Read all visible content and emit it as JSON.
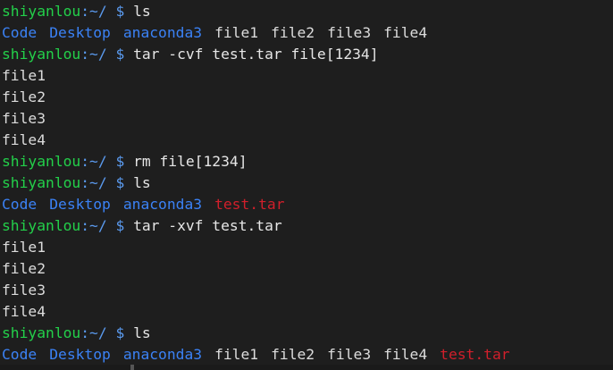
{
  "prompt": {
    "user": "shiyanlou",
    "sep": ":~/ $ "
  },
  "lines": [
    {
      "type": "cmd",
      "text": "ls"
    },
    {
      "type": "ls",
      "items": [
        {
          "text": "Code",
          "kind": "dir"
        },
        {
          "text": "Desktop",
          "kind": "dir"
        },
        {
          "text": "anaconda3",
          "kind": "dir"
        },
        {
          "text": "file1",
          "kind": "file"
        },
        {
          "text": "file2",
          "kind": "file"
        },
        {
          "text": "file3",
          "kind": "file"
        },
        {
          "text": "file4",
          "kind": "file"
        }
      ]
    },
    {
      "type": "cmd",
      "text": "tar -cvf test.tar file[1234]"
    },
    {
      "type": "out",
      "text": "file1"
    },
    {
      "type": "out",
      "text": "file2"
    },
    {
      "type": "out",
      "text": "file3"
    },
    {
      "type": "out",
      "text": "file4"
    },
    {
      "type": "cmd",
      "text": "rm file[1234]"
    },
    {
      "type": "cmd",
      "text": "ls"
    },
    {
      "type": "ls",
      "items": [
        {
          "text": "Code",
          "kind": "dir"
        },
        {
          "text": "Desktop",
          "kind": "dir"
        },
        {
          "text": "anaconda3",
          "kind": "dir"
        },
        {
          "text": "test.tar",
          "kind": "archive"
        }
      ]
    },
    {
      "type": "cmd",
      "text": "tar -xvf test.tar"
    },
    {
      "type": "out",
      "text": "file1"
    },
    {
      "type": "out",
      "text": "file2"
    },
    {
      "type": "out",
      "text": "file3"
    },
    {
      "type": "out",
      "text": "file4"
    },
    {
      "type": "cmd",
      "text": "ls"
    },
    {
      "type": "ls",
      "items": [
        {
          "text": "Code",
          "kind": "dir"
        },
        {
          "text": "Desktop",
          "kind": "dir"
        },
        {
          "text": "anaconda3",
          "kind": "dir"
        },
        {
          "text": "file1",
          "kind": "file"
        },
        {
          "text": "file2",
          "kind": "file"
        },
        {
          "text": "file3",
          "kind": "file"
        },
        {
          "text": "file4",
          "kind": "file"
        },
        {
          "text": "test.tar",
          "kind": "archive"
        }
      ]
    }
  ],
  "colors": {
    "background": "#1e1e1e",
    "prompt_user": "#23d04a",
    "prompt_path": "#5b9bf0",
    "directory": "#3b82f6",
    "archive": "#d11f2b",
    "text": "#dcdcdc"
  }
}
